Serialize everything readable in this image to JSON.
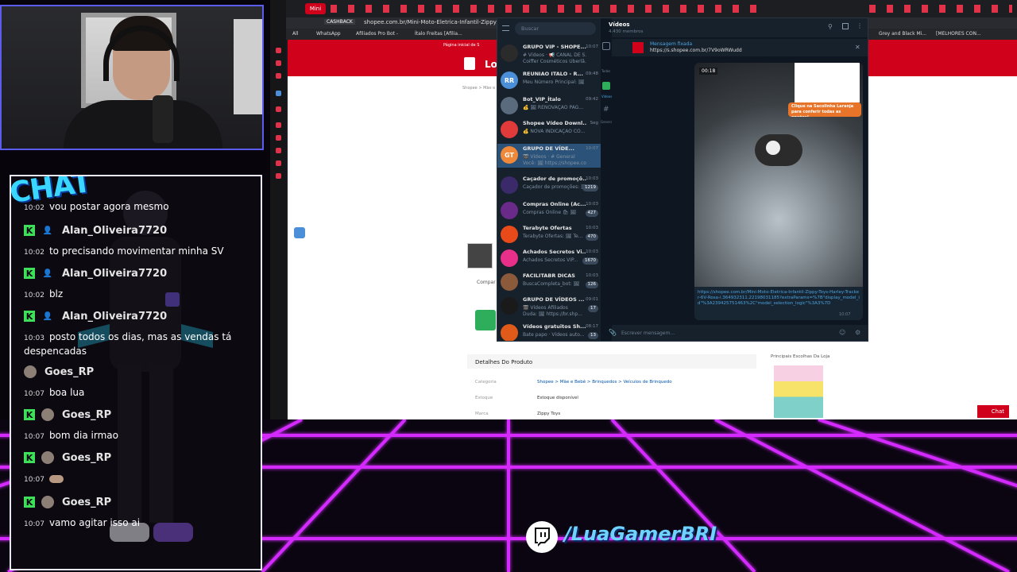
{
  "stream": {
    "channel_handle": "/LuaGamerBRI",
    "chat_logo": "CHAT"
  },
  "chat": {
    "messages": [
      {
        "user": "",
        "time": "10:02",
        "text": "vou postar agora mesmo",
        "badge": "k"
      },
      {
        "user": "Alan_Oliveira7720",
        "time": "10:02",
        "text": "to precisando movimentar minha SV",
        "badge": "k"
      },
      {
        "user": "Alan_Oliveira7720",
        "time": "10:02",
        "text": "blz",
        "badge": "k"
      },
      {
        "user": "Alan_Oliveira7720",
        "time": "10:03",
        "text": "posto todos os dias, mas as vendas tá",
        "text2": "despencadas",
        "badge": "k"
      },
      {
        "user": "Goes_RP",
        "time": "10:07",
        "text": "boa lua",
        "badge": "none"
      },
      {
        "user": "Goes_RP",
        "time": "10:07",
        "text": "bom dia irmao",
        "badge": "k"
      },
      {
        "user": "Goes_RP",
        "time": "10:07",
        "text": "",
        "badge": "k"
      },
      {
        "user": "Goes_RP",
        "time": "10:07",
        "text": "vamo agitar isso ai",
        "badge": "k"
      }
    ]
  },
  "browser": {
    "active_tab": "Mini",
    "url": "shopee.com.br/Mini-Moto-Eletrica-Infantil-Zippy-Toys",
    "cashback_label": "CASHBACK",
    "bookmarks": [
      "All",
      "WhatsApp",
      "Afiliados Pro Bot -",
      "Ítalo Freitas [Afilia...",
      "Grey and Black Mi...",
      "[MELHORES CON..."
    ],
    "shopee": {
      "logo_text": "Lo",
      "top_text": "Página inicial de S",
      "breadcrumb": "Shopee > Mãe e",
      "share_label": "Compar",
      "details_title": "Detalhes Do Produto",
      "details_rows": [
        {
          "label": "Categoria",
          "value": "Shopee > Mãe e Bebê > Brinquedos > Veículos de Brinquedo"
        },
        {
          "label": "Estoque",
          "value": "Estoque disponível"
        },
        {
          "label": "Marca",
          "value": "Zippy Toys"
        }
      ],
      "store_heading": "Principais Escolhas Da Loja",
      "chat_button": "Chat"
    }
  },
  "telegram": {
    "search_placeholder": "Buscar",
    "header_title": "Vídeos",
    "header_subtitle": "4.430 membros",
    "folders": [
      "Todos",
      "Vídeos",
      "General"
    ],
    "pinned_label": "Mensagem fixada",
    "pinned_link": "https://s.shopee.com.br/7V9oWRWudd",
    "video_duration": "00:18",
    "video_banner": "Clique na Sacolinha Laranja para conferir todas as opções!",
    "message_link": "https://shopee.com.br/Mini-Moto-Eletrica-Infantil-Zippy-Toys-Harley-Tracker-6V-Rosa-i.364932311.22198031185?extraParams=%7B\"display_model_id\"%3A239425751463%2C\"model_selection_logic\"%3A3%7D",
    "message_time": "10:07",
    "compose_placeholder": "Escrever mensagem...",
    "chats": [
      {
        "title": "GRUPO VIP - SHOPE...",
        "time": "10:07",
        "preview": "# Vídeos · 📢 CANAL DE S...",
        "preview2": "Coiffer Cosméticos Uberlâ...",
        "badge": "",
        "avatar": "",
        "color": "#2b2b2b"
      },
      {
        "title": "REUNIAO ITALO - R...",
        "time": "09:48",
        "preview": "Meu Número Principal: 🖼",
        "badge": "",
        "avatar": "RR",
        "color": "#4a8fd8"
      },
      {
        "title": "Bot_VIP_Ítalo",
        "time": "09:42",
        "preview": "💰 🖼 RENOVAÇÃO PAG...",
        "badge": "",
        "avatar": "",
        "color": "#5b6b7e"
      },
      {
        "title": "Shopee Vídeo Downl...",
        "time": "Seg",
        "preview": "💰 NOVA INDICAÇÃO CO...",
        "badge": "",
        "avatar": "",
        "color": "#e03a3a"
      },
      {
        "title": "GRUPO DE VÍDE...",
        "time": "10:07",
        "preview": "🎬 Vídeos · # General",
        "preview2": "Você: 🖼 https://shopee.com...",
        "badge": "",
        "avatar": "GT",
        "color": "#f0883a"
      },
      {
        "title": "Caçador de promoçõ...",
        "time": "10:03",
        "preview": "Caçador de promoções: 🖼",
        "badge": "1219",
        "avatar": "",
        "color": "#3a2a6a"
      },
      {
        "title": "Compras Online (Ac...",
        "time": "10:03",
        "preview": "Compras Online 🛍 🖼",
        "badge": "427",
        "avatar": "",
        "color": "#6a2a8a"
      },
      {
        "title": "Terabyte Ofertas",
        "time": "10:03",
        "preview": "Terabyte Ofertas: 🖼 Te...",
        "badge": "470",
        "avatar": "",
        "color": "#e84a1a"
      },
      {
        "title": "Achados Secretos Vi...",
        "time": "10:03",
        "preview": "Achados Secretos VIP...",
        "badge": "1670",
        "avatar": "",
        "color": "#e8308a"
      },
      {
        "title": "FACILITABR DICAS",
        "time": "10:03",
        "preview": "BuscaCompleta_bot: 🖼",
        "badge": "126",
        "avatar": "",
        "color": "#8a5a3a"
      },
      {
        "title": "GRUPO DE VÍDEOS ...",
        "time": "09:01",
        "preview": "🎬 Vídeos Afiliados",
        "preview2": "Duda: 🖼 https://br.shp...",
        "badge": "17",
        "avatar": "",
        "color": "#1a1a1a"
      },
      {
        "title": "Vídeos gratuitos Sh...",
        "time": "08:17",
        "preview": "Bate papo · Vídeos auto...",
        "badge": "13",
        "avatar": "",
        "color": "#e05a1a"
      }
    ]
  }
}
